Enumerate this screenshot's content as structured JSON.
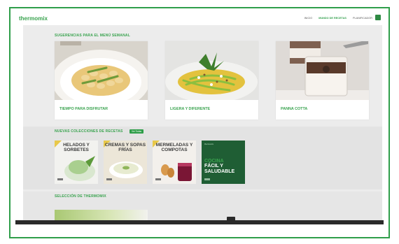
{
  "brand": {
    "name": "thermomix"
  },
  "nav": {
    "items": [
      "INICIO",
      "MUNDO DE RECETAS",
      "PLANIFICADOR"
    ],
    "active": 1
  },
  "section1": {
    "title": "SUGERENCIAS PARA EL MENÚ SEMANAL",
    "cards": [
      {
        "caption": "TIEMPO PARA DISFRUTAR"
      },
      {
        "caption": "LIGERA Y DIFERENTE"
      },
      {
        "caption": "PANNA COTTA"
      }
    ]
  },
  "section2": {
    "title": "NUEVAS COLECCIONES DE RECETAS",
    "badge": "Ver Todas",
    "collections": [
      {
        "title": "HELADOS Y SORBETES"
      },
      {
        "title": "CREMAS Y SOPAS FRÍAS"
      },
      {
        "title": "MERMELADAS Y COMPOTAS"
      },
      {
        "brand_small": "thermomix",
        "title1": "COCINA",
        "title2": "FÁCIL Y SALUDABLE"
      }
    ]
  },
  "section3": {
    "title": "SELECCIÓN DE THERMOMIX"
  },
  "colors": {
    "accent": "#3aa34f",
    "border": "#2f9e4a",
    "dark_tile": "#1f5e34"
  }
}
